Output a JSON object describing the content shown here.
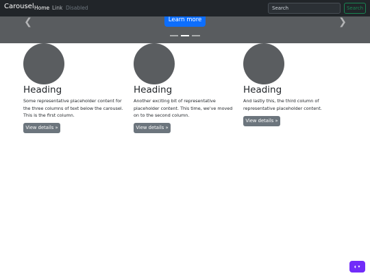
{
  "navbar": {
    "brand": "Carousel",
    "links": [
      {
        "label": "Home",
        "state": "active"
      },
      {
        "label": "Link",
        "state": "normal"
      },
      {
        "label": "Disabled",
        "state": "disabled"
      }
    ],
    "search": {
      "placeholder": "Search",
      "value": ""
    },
    "search_button": "Search"
  },
  "carousel": {
    "cta": "Learn more",
    "prev_icon": "chevron-left-icon",
    "next_icon": "chevron-right-icon",
    "slide_count": 3,
    "active_slide": 2
  },
  "columns": [
    {
      "heading": "Heading",
      "text": "Some representative placeholder content for the three columns of text below the carousel. This is the first column.",
      "button": "View details »"
    },
    {
      "heading": "Heading",
      "text": "Another exciting bit of representative placeholder content. This time, we've moved on to the second column.",
      "button": "View details »"
    },
    {
      "heading": "Heading",
      "text": "And lastly this, the third column of representative placeholder content.",
      "button": "View details »"
    }
  ],
  "theme_toggle": {
    "icon": "circle-half-icon",
    "caret": "chevron-down-icon"
  },
  "colors": {
    "navbar_bg": "#212529",
    "carousel_bg": "#595c5f",
    "primary": "#0d6efd",
    "success": "#198754",
    "secondary": "#6c757d",
    "theme_toggle": "#712cf9"
  }
}
